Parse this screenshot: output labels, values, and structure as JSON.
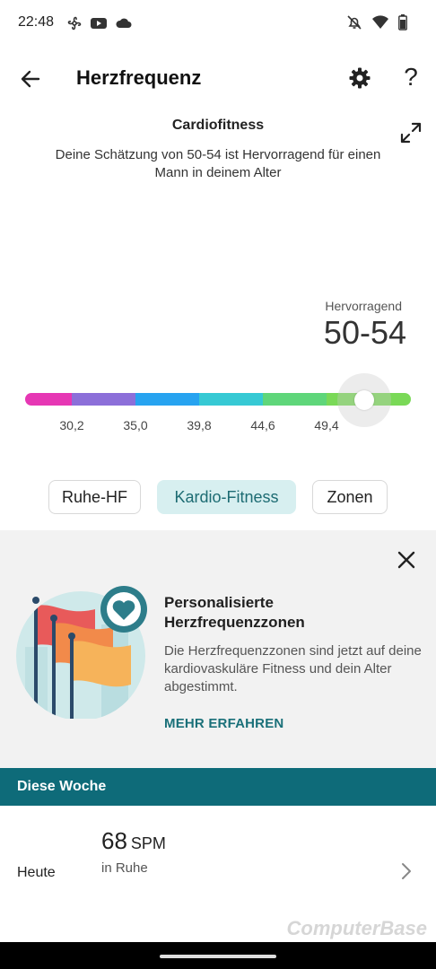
{
  "status_bar": {
    "time": "22:48",
    "left_icons": [
      "fan-icon",
      "youtube-icon",
      "cloud-icon"
    ],
    "right_icons": [
      "bell-off-icon",
      "wifi-icon",
      "battery-icon"
    ]
  },
  "header": {
    "title": "Herzfrequenz",
    "help_label": "?"
  },
  "cardio": {
    "title": "Cardiofitness",
    "description": "Deine Schätzung von 50-54 ist Hervorragend für einen Mann in deinem Alter",
    "rating_label": "Hervorragend",
    "rating_value": "50-54",
    "gauge_position": 0.88,
    "gauge_colors": [
      "#e637b4",
      "#8c6fd9",
      "#27a3f0",
      "#36c9d4",
      "#5fd67a",
      "#7ad957"
    ],
    "ticks": [
      "30,2",
      "35,0",
      "39,8",
      "44,6",
      "49,4"
    ]
  },
  "tabs": [
    {
      "label": "Ruhe-HF",
      "active": false
    },
    {
      "label": "Kardio-Fitness",
      "active": true
    },
    {
      "label": "Zonen",
      "active": false
    }
  ],
  "promo": {
    "title": "Personalisierte Herzfrequenzzonen",
    "text": "Die Herzfrequenzzonen sind jetzt auf deine kardiovaskuläre Fitness und dein Alter abgestimmt.",
    "link": "MEHR ERFAHREN"
  },
  "week": {
    "title": "Diese Woche",
    "today_label": "Heute",
    "today_value": "68",
    "today_unit": "SPM",
    "today_sub": "in Ruhe"
  },
  "watermark": "ComputerBase",
  "colors": {
    "accent": "#0e6b79",
    "tab_active_bg": "#d7eff0",
    "link": "#1a7079"
  }
}
